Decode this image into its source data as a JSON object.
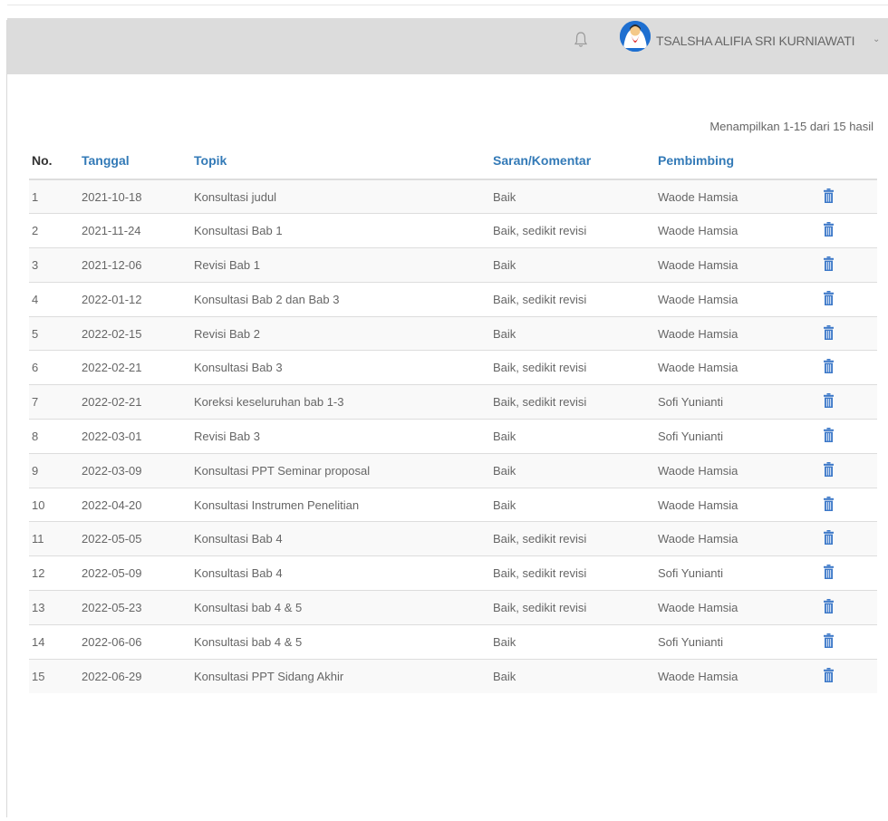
{
  "header": {
    "user_name": "TSALSHA ALIFIA SRI KURNIAWATI",
    "icons": {
      "notification": "bell-icon",
      "avatar": "user-avatar",
      "menu": "chevron-down-icon"
    },
    "caret": "⌄"
  },
  "summary": "Menampilkan 1-15 dari 15 hasil",
  "table": {
    "columns": [
      "No.",
      "Tanggal",
      "Topik",
      "Saran/Komentar",
      "Pembimbing"
    ],
    "rows": [
      {
        "no": "1",
        "date": "2021-10-18",
        "topic": "Konsultasi judul",
        "comment": "Baik",
        "advisor": "Waode Hamsia"
      },
      {
        "no": "2",
        "date": "2021-11-24",
        "topic": "Konsultasi Bab 1",
        "comment": "Baik, sedikit revisi",
        "advisor": "Waode Hamsia"
      },
      {
        "no": "3",
        "date": "2021-12-06",
        "topic": "Revisi Bab 1",
        "comment": "Baik",
        "advisor": "Waode Hamsia"
      },
      {
        "no": "4",
        "date": "2022-01-12",
        "topic": "Konsultasi Bab 2 dan Bab 3",
        "comment": "Baik, sedikit revisi",
        "advisor": "Waode Hamsia"
      },
      {
        "no": "5",
        "date": "2022-02-15",
        "topic": "Revisi Bab 2",
        "comment": "Baik",
        "advisor": "Waode Hamsia"
      },
      {
        "no": "6",
        "date": "2022-02-21",
        "topic": "Konsultasi Bab 3",
        "comment": "Baik, sedikit revisi",
        "advisor": "Waode Hamsia"
      },
      {
        "no": "7",
        "date": "2022-02-21",
        "topic": "Koreksi keseluruhan bab 1-3",
        "comment": "Baik, sedikit revisi",
        "advisor": "Sofi Yunianti"
      },
      {
        "no": "8",
        "date": "2022-03-01",
        "topic": "Revisi Bab 3",
        "comment": "Baik",
        "advisor": "Sofi Yunianti"
      },
      {
        "no": "9",
        "date": "2022-03-09",
        "topic": "Konsultasi PPT Seminar proposal",
        "comment": "Baik",
        "advisor": "Waode Hamsia"
      },
      {
        "no": "10",
        "date": "2022-04-20",
        "topic": "Konsultasi Instrumen Penelitian",
        "comment": "Baik",
        "advisor": "Waode Hamsia"
      },
      {
        "no": "11",
        "date": "2022-05-05",
        "topic": "Konsultasi Bab 4",
        "comment": "Baik, sedikit revisi",
        "advisor": "Waode Hamsia"
      },
      {
        "no": "12",
        "date": "2022-05-09",
        "topic": "Konsultasi Bab 4",
        "comment": "Baik, sedikit revisi",
        "advisor": "Sofi Yunianti"
      },
      {
        "no": "13",
        "date": "2022-05-23",
        "topic": "Konsultasi bab 4 & 5",
        "comment": "Baik, sedikit revisi",
        "advisor": "Waode Hamsia"
      },
      {
        "no": "14",
        "date": "2022-06-06",
        "topic": "Konsultasi bab 4 & 5",
        "comment": "Baik",
        "advisor": "Sofi Yunianti"
      },
      {
        "no": "15",
        "date": "2022-06-29",
        "topic": "Konsultasi PPT Sidang Akhir",
        "comment": "Baik",
        "advisor": "Waode Hamsia"
      }
    ]
  },
  "colors": {
    "header_bg": "#dcdcdc",
    "link_blue": "#337ab7",
    "trash_blue": "#3c78c8",
    "avatar_blue": "#1e6fd0"
  }
}
